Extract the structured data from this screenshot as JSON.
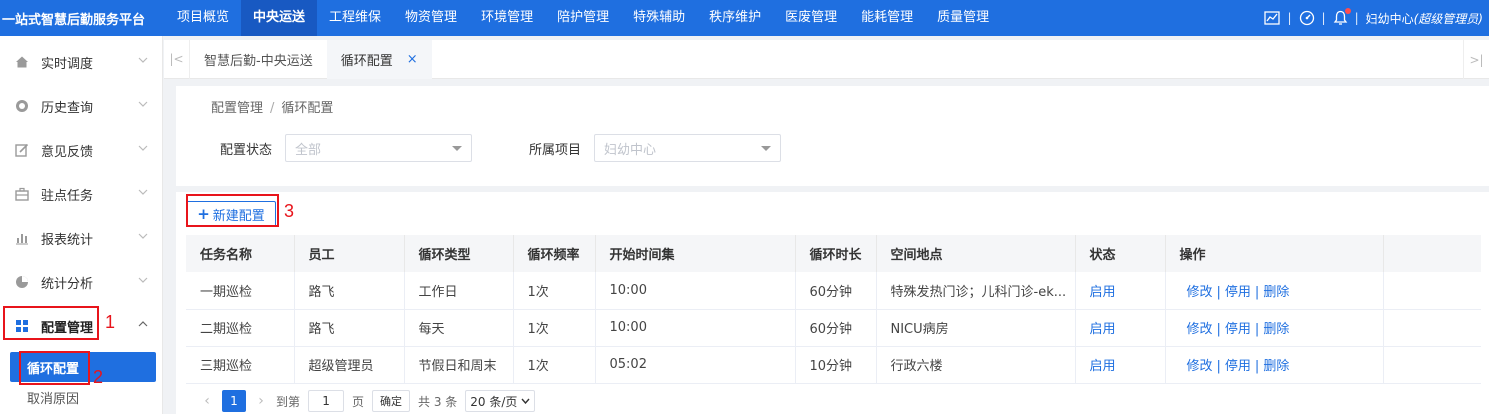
{
  "app": {
    "brand": "一站式智慧后勤服务平台"
  },
  "topnav": {
    "items": [
      "项目概览",
      "中央运送",
      "工程维保",
      "物资管理",
      "环境管理",
      "陪护管理",
      "特殊辅助",
      "秩序维护",
      "医废管理",
      "能耗管理",
      "质量管理"
    ],
    "active_index": 1
  },
  "user": {
    "org": "妇幼中心",
    "role": "(超级管理员)"
  },
  "sidebar": {
    "items": [
      {
        "label": "实时调度",
        "icon": "home-icon"
      },
      {
        "label": "历史查询",
        "icon": "history-icon"
      },
      {
        "label": "意见反馈",
        "icon": "edit-icon"
      },
      {
        "label": "驻点任务",
        "icon": "briefcase-icon"
      },
      {
        "label": "报表统计",
        "icon": "bar-chart-icon"
      },
      {
        "label": "统计分析",
        "icon": "pie-chart-icon"
      },
      {
        "label": "配置管理",
        "icon": "grid-icon"
      }
    ],
    "submenu": [
      "循环配置",
      "取消原因"
    ]
  },
  "tabs": [
    {
      "label": "智慧后勤-中央运送"
    },
    {
      "label": "循环配置",
      "close": "×"
    }
  ],
  "breadcrumb": {
    "parent": "配置管理",
    "sep": "/",
    "current": "循环配置"
  },
  "filters": {
    "status_label": "配置状态",
    "status_value": "全部",
    "project_label": "所属项目",
    "project_value": "妇幼中心"
  },
  "toolbar": {
    "new_label": "新建配置"
  },
  "table": {
    "headers": [
      "任务名称",
      "员工",
      "循环类型",
      "循环频率",
      "开始时间集",
      "循环时长",
      "空间地点",
      "状态",
      "操作"
    ],
    "rows": [
      {
        "name": "一期巡检",
        "employee": "路飞",
        "type": "工作日",
        "freq": "1次",
        "start": "10:00",
        "duration": "60分钟",
        "place": "特殊发热门诊；儿科门诊-ek...",
        "status": "启用"
      },
      {
        "name": "二期巡检",
        "employee": "路飞",
        "type": "每天",
        "freq": "1次",
        "start": "10:00",
        "duration": "60分钟",
        "place": "NICU病房",
        "status": "启用"
      },
      {
        "name": "三期巡检",
        "employee": "超级管理员",
        "type": "节假日和周末",
        "freq": "1次",
        "start": "05:02",
        "duration": "10分钟",
        "place": "行政六楼",
        "status": "启用"
      }
    ],
    "ops": {
      "edit": "修改",
      "disable": "停用",
      "delete": "删除",
      "sep": "|"
    }
  },
  "pager": {
    "current_page": "1",
    "goto_label": "到第",
    "goto_value": "1",
    "page_unit": "页",
    "confirm": "确定",
    "total": "共 3 条",
    "page_size": "20 条/页"
  },
  "annotations": {
    "one": "1",
    "two": "2",
    "three": "3"
  },
  "colors": {
    "primary": "#1f6fe0",
    "annotation": "#e8141b"
  }
}
